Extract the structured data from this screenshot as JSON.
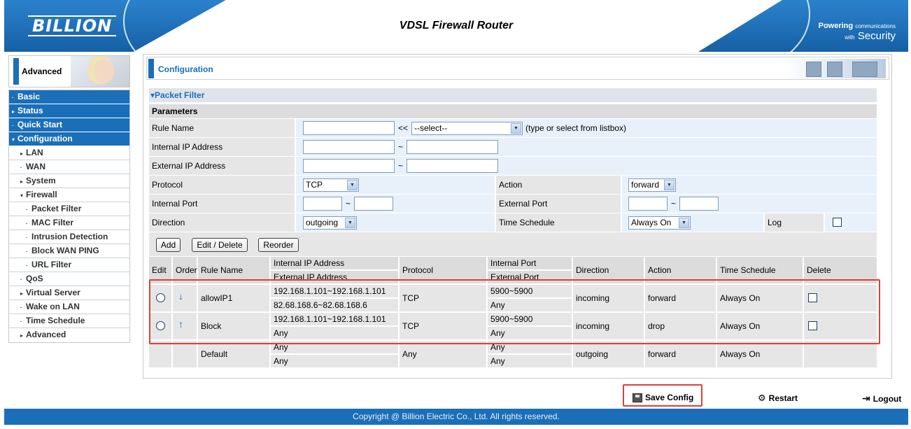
{
  "header": {
    "logo": "BILLION",
    "title": "VDSL Firewall Router",
    "tagline_a": "Powering",
    "tagline_b": "communications",
    "tagline_c": "with",
    "tagline_d": "Security"
  },
  "sidebar": {
    "mode_label": "Advanced",
    "items": [
      {
        "label": "Basic",
        "marker": "·"
      },
      {
        "label": "Status",
        "marker": "▸"
      },
      {
        "label": "Quick Start",
        "marker": "·"
      },
      {
        "label": "Configuration",
        "marker": "▾"
      },
      {
        "label": "LAN",
        "marker": "▸"
      },
      {
        "label": "WAN",
        "marker": "·"
      },
      {
        "label": "System",
        "marker": "▸"
      },
      {
        "label": "Firewall",
        "marker": "▾"
      },
      {
        "label": "Packet Filter",
        "marker": "·"
      },
      {
        "label": "MAC Filter",
        "marker": "·"
      },
      {
        "label": "Intrusion Detection",
        "marker": "·"
      },
      {
        "label": "Block WAN PING",
        "marker": "·"
      },
      {
        "label": "URL Filter",
        "marker": "·"
      },
      {
        "label": "QoS",
        "marker": "·"
      },
      {
        "label": "Virtual Server",
        "marker": "▸"
      },
      {
        "label": "Wake on LAN",
        "marker": "·"
      },
      {
        "label": "Time Schedule",
        "marker": "·"
      },
      {
        "label": "Advanced",
        "marker": "▸"
      }
    ]
  },
  "main": {
    "section_title": "Configuration",
    "panel_title": "▾Packet Filter",
    "params_title": "Parameters"
  },
  "form": {
    "rule_name_label": "Rule Name",
    "rule_name_value": "",
    "rule_name_sep": "<<",
    "rule_select_value": "--select--",
    "rule_hint": "(type or select from listbox)",
    "internal_ip_label": "Internal IP Address",
    "external_ip_label": "External IP Address",
    "range_sep": "~",
    "protocol_label": "Protocol",
    "protocol_value": "TCP",
    "action_label": "Action",
    "action_value": "forward",
    "internal_port_label": "Internal Port",
    "external_port_label": "External Port",
    "direction_label": "Direction",
    "direction_value": "outgoing",
    "time_schedule_label": "Time Schedule",
    "time_schedule_value": "Always On",
    "log_label": "Log"
  },
  "buttons": {
    "add": "Add",
    "edit_delete": "Edit / Delete",
    "reorder": "Reorder"
  },
  "table": {
    "headers": {
      "edit": "Edit",
      "order": "Order",
      "rule_name": "Rule Name",
      "internal_ip": "Internal IP Address",
      "external_ip": "External IP Address",
      "protocol": "Protocol",
      "internal_port": "Internal Port",
      "external_port": "External Port",
      "direction": "Direction",
      "action": "Action",
      "time_schedule": "Time Schedule",
      "delete": "Delete"
    },
    "rows": [
      {
        "name": "allowIP1",
        "int_ip": "192.168.1.101~192.168.1.101",
        "ext_ip": "82.68.168.6~82.68.168.6",
        "protocol": "TCP",
        "int_port": "5900~5900",
        "ext_port": "Any",
        "direction": "incoming",
        "action": "forward",
        "schedule": "Always On",
        "order_icon": "down-arrow"
      },
      {
        "name": "Block",
        "int_ip": "192.168.1.101~192.168.1.101",
        "ext_ip": "Any",
        "protocol": "TCP",
        "int_port": "5900~5900",
        "ext_port": "Any",
        "direction": "incoming",
        "action": "drop",
        "schedule": "Always On",
        "order_icon": "up-arrow"
      },
      {
        "name": "Default",
        "int_ip": "Any",
        "ext_ip": "Any",
        "protocol": "Any",
        "int_port": "Any",
        "ext_port": "Any",
        "direction": "outgoing",
        "action": "forward",
        "schedule": "Always On"
      }
    ]
  },
  "bottom": {
    "save_config": "Save Config",
    "restart": "Restart",
    "logout": "Logout"
  },
  "footer": {
    "copyright": "Copyright @ Billion Electric Co., Ltd. All rights reserved."
  },
  "colors": {
    "brand_blue": "#1a6fb8",
    "highlight_red": "#d9413a"
  }
}
